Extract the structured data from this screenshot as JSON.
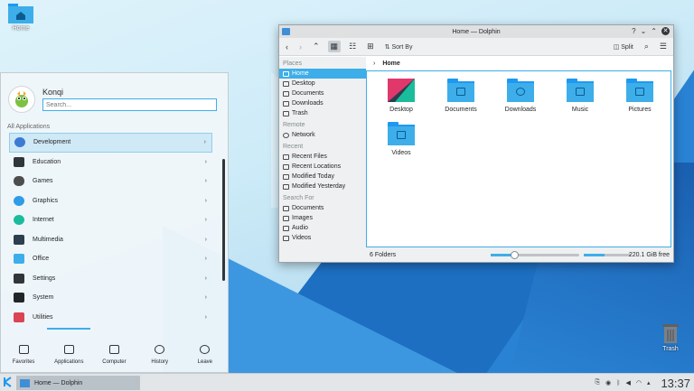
{
  "desktop": {
    "icons": [
      {
        "label": "Home",
        "icon": "folder-home-icon"
      },
      {
        "label": "Trash",
        "icon": "trash-icon"
      }
    ]
  },
  "dolphin": {
    "title": "Home — Dolphin",
    "toolbar": {
      "sort_label": "Sort By",
      "split_label": "Split"
    },
    "sidebar": {
      "places_header": "Places",
      "places": [
        "Home",
        "Desktop",
        "Documents",
        "Downloads",
        "Trash"
      ],
      "remote_header": "Remote",
      "remote": [
        "Network"
      ],
      "recent_header": "Recent",
      "recent": [
        "Recent Files",
        "Recent Locations",
        "Modified Today",
        "Modified Yesterday"
      ],
      "searchfor_header": "Search For",
      "searchfor": [
        "Documents",
        "Images",
        "Audio",
        "Videos"
      ]
    },
    "breadcrumb": "Home",
    "folders": [
      "Desktop",
      "Documents",
      "Downloads",
      "Music",
      "Pictures",
      "Videos"
    ],
    "status": {
      "count": "6 Folders",
      "free": "220.1 GiB free",
      "zoom_fraction": 0.26,
      "used_fraction": 0.45
    }
  },
  "launcher": {
    "username": "Konqi",
    "search_placeholder": "Search...",
    "section_label": "All Applications",
    "categories": [
      "Development",
      "Education",
      "Games",
      "Graphics",
      "Internet",
      "Multimedia",
      "Office",
      "Settings",
      "System",
      "Utilities"
    ],
    "nav": [
      "Favorites",
      "Applications",
      "Computer",
      "History",
      "Leave"
    ]
  },
  "taskbar": {
    "task_label": "Home — Dolphin",
    "clock": "13:37"
  },
  "colors": {
    "accent": "#3daee9",
    "folder": "#1d99f3"
  }
}
